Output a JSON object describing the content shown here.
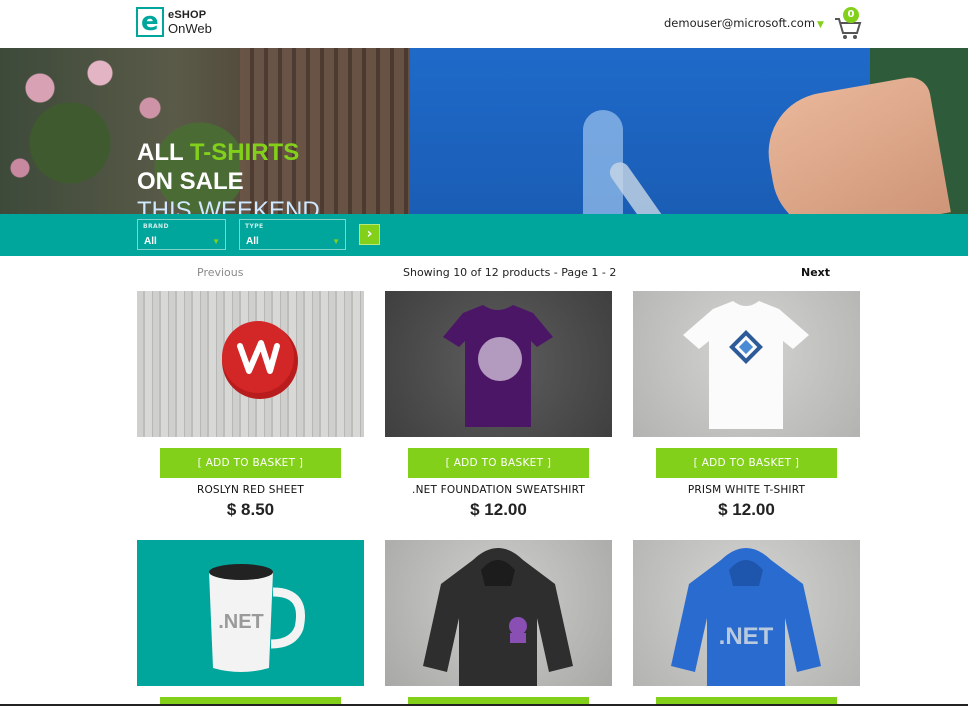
{
  "header": {
    "logo_line1": "eSHOP",
    "logo_line2": "OnWeb",
    "user_email": "demouser@microsoft.com",
    "cart_count": "0",
    "icons": [
      "logo-e-icon",
      "chevron-down-icon",
      "cart-icon"
    ]
  },
  "hero": {
    "line1_a": "ALL ",
    "line1_b": "T-SHIRTS",
    "line2": "ON SALE",
    "line3": "THIS WEEKEND"
  },
  "filter": {
    "brand_label": "BRAND",
    "brand_value": "All",
    "type_label": "TYPE",
    "type_value": "All",
    "submit_icon": "chevron-right-icon"
  },
  "pager": {
    "previous": "Previous",
    "info": "Showing 10 of 12 products - Page 1 - 2",
    "next": "Next"
  },
  "buttons": {
    "add_to_basket": "[ ADD TO BASKET ]"
  },
  "products": [
    {
      "name": "ROSLYN RED SHEET",
      "price": "$ 8.50"
    },
    {
      "name": ".NET FOUNDATION SWEATSHIRT",
      "price": "$ 12.00"
    },
    {
      "name": "PRISM WHITE T-SHIRT",
      "price": "$ 12.00"
    }
  ],
  "images": {
    "mug_text": ".NET",
    "hoodie_text": ".NET"
  },
  "colors": {
    "teal": "#00a69c",
    "green": "#83d01b",
    "shirt_blue": "#1f6ac9"
  }
}
